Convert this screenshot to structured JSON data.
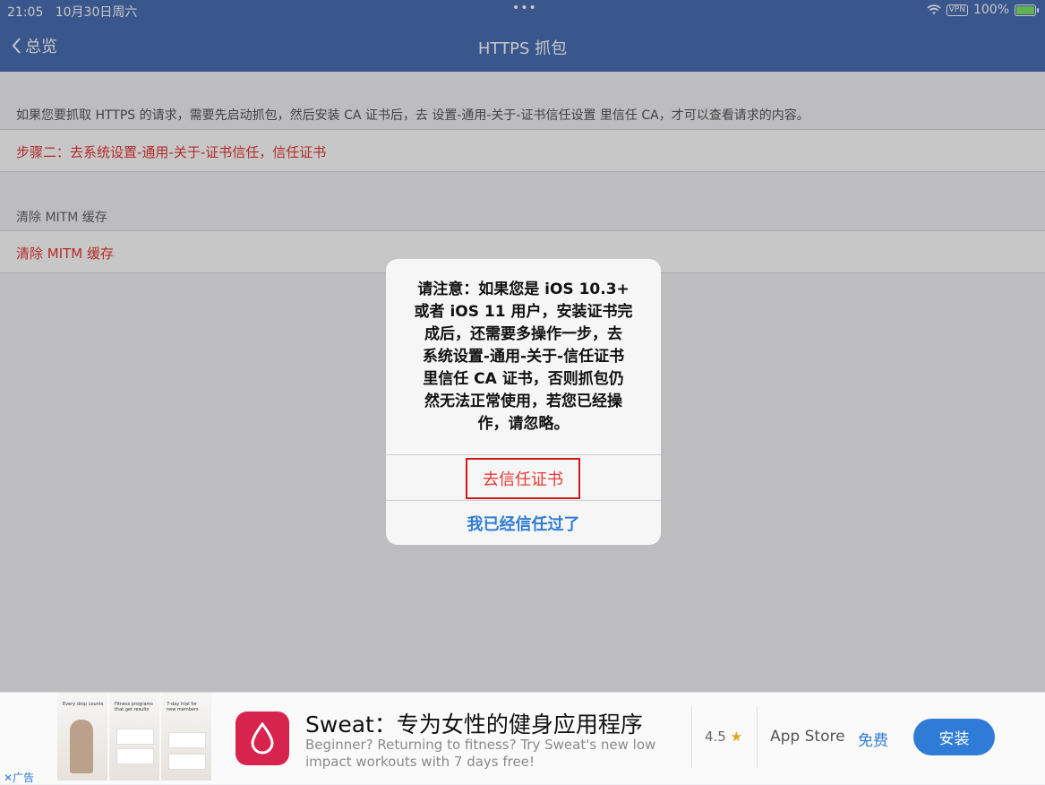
{
  "status_bar": {
    "time": "21:05",
    "date": "10月30日周六",
    "dots": "•••",
    "vpn": "VPN",
    "battery": "100%"
  },
  "nav": {
    "back_label": "总览",
    "title": "HTTPS 抓包"
  },
  "content": {
    "description": "如果您要抓取 HTTPS 的请求，需要先启动抓包，然后安装 CA 证书后，去 设置-通用-关于-证书信任设置 里信任 CA，才可以查看请求的内容。",
    "step_two": "步骤二：去系统设置-通用-关于-证书信任，信任证书",
    "section_header": "清除 MITM 缓存",
    "clear_cache": "清除 MITM 缓存"
  },
  "alert": {
    "lines": [
      "请注意：如果您是 iOS 10.3+",
      "或者 iOS 11 用户，安装证书完",
      "成后，还需要多操作一步，去",
      "系统设置-通用-关于-信任证书",
      "里信任 CA 证书，否则抓包仍",
      "然无法正常使用，若您已经操",
      "作，请忽略。"
    ],
    "primary_button": "去信任证书",
    "secondary_button": "我已经信任过了"
  },
  "ad": {
    "screenshot_captions": [
      "Every drop counts",
      "Fitness programs that get results",
      "7-day trial for new members"
    ],
    "title": "Sweat：专为女性的健身应用程序",
    "subtitle": "Beginner? Returning to fitness? Try Sweat's new low impact workouts with 7 days free!",
    "rating": "4.5",
    "rating_star": "★",
    "store": "App Store",
    "price": "免费",
    "install": "安装",
    "ad_label": "广告",
    "close": "✕"
  }
}
